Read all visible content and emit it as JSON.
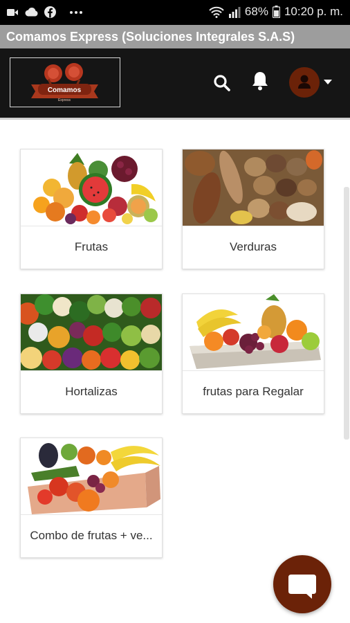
{
  "status_bar": {
    "battery_percent": "68%",
    "time": "10:20 p. m.",
    "icons": [
      "video-icon",
      "cloud-icon",
      "facebook-icon",
      "more-icon",
      "wifi-icon",
      "signal-icon",
      "battery-icon"
    ]
  },
  "title_bar": {
    "title": "Comamos Express (Soluciones Integrales S.A.S)"
  },
  "app_header": {
    "logo_text": "Comamos",
    "logo_subtext": "Express",
    "icons": [
      "search-icon",
      "bell-icon",
      "user-icon",
      "caret-down-icon"
    ]
  },
  "categories": [
    {
      "label": "Frutas"
    },
    {
      "label": "Verduras"
    },
    {
      "label": "Hortalizas"
    },
    {
      "label": "frutas para Regalar"
    },
    {
      "label": "Combo de frutas + ve..."
    }
  ],
  "chat_button": {
    "icon": "chat-icon"
  },
  "colors": {
    "brand_brown": "#6b2208",
    "header_bg": "#151515",
    "title_bar_bg": "#9d9d9d"
  }
}
